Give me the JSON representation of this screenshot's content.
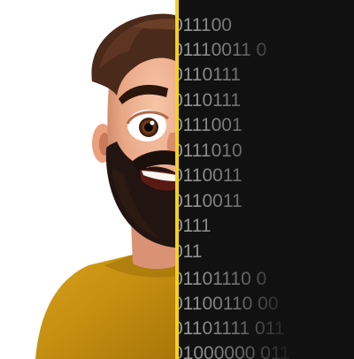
{
  "theme": {
    "divider_color": "#f5d21c",
    "panel_background": "#111111",
    "binary_text_color": "#b8b8b8"
  },
  "illustration": {
    "icon": "cartoon-bearded-man-half-face"
  },
  "binary_lines": [
    "011100",
    "01110011 0",
    "0110111",
    "0110111",
    "0111001",
    "0111010",
    "0110011",
    "0110011",
    "0111",
    "011",
    "01101110 0",
    "01100110 00",
    "01101111 011",
    "01000000 011"
  ]
}
